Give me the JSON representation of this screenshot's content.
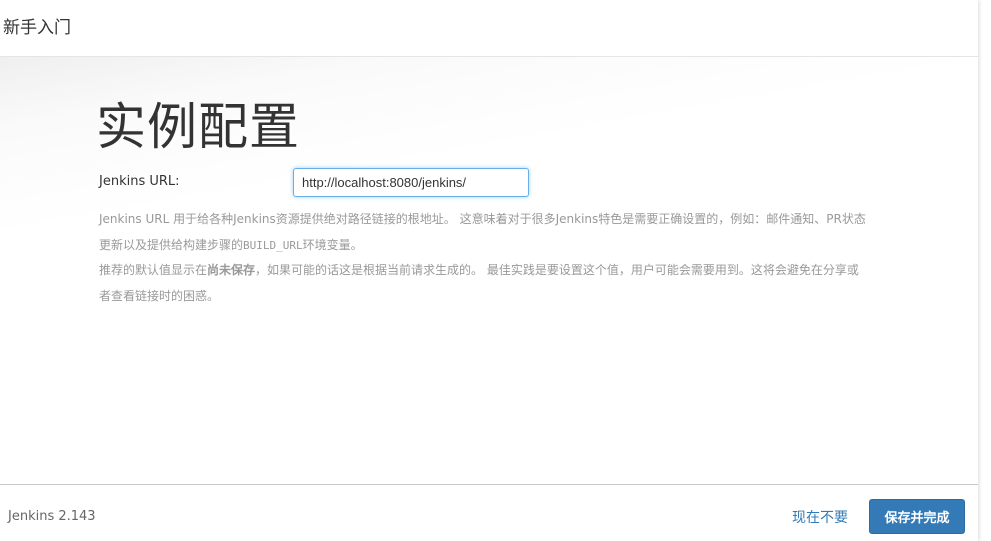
{
  "header": {
    "title": "新手入门"
  },
  "main": {
    "heading": "实例配置",
    "url_label": "Jenkins URL:",
    "url_value": "http://localhost:8080/jenkins/",
    "help": {
      "p1_a": "Jenkins URL 用于给各种Jenkins资源提供绝对路径链接的根地址。 这意味着对于很多Jenkins特色是需要正确设置的，例如：邮件通知、PR状态更新以及提供给构建步骤的",
      "p1_code": "BUILD_URL",
      "p1_b": "环境变量。",
      "p2_a": "推荐的默认值显示在",
      "p2_bold": "尚未保存",
      "p2_b": "，如果可能的话这是根据当前请求生成的。 最佳实践是要设置这个值，用户可能会需要用到。这将会避免在分享或者查看链接时的困惑。"
    }
  },
  "footer": {
    "version": "Jenkins 2.143",
    "skip_label": "现在不要",
    "save_label": "保存并完成"
  },
  "colors": {
    "primary": "#337ab7",
    "input_focus": "#66afe9",
    "help_text": "#999999"
  }
}
